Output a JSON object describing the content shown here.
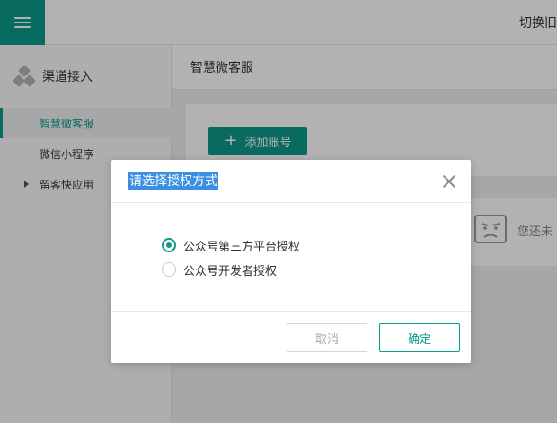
{
  "topbar": {
    "menu_icon": "hamburger-icon",
    "switch_label": "切换旧"
  },
  "sidebar": {
    "section_icon": "hexagon-cluster-icon",
    "section_title": "渠道接入",
    "items": [
      {
        "label": "智慧微客服",
        "active": true
      },
      {
        "label": "微信小程序",
        "active": false
      },
      {
        "label": "留客快应用",
        "active": false,
        "expandable": true
      }
    ]
  },
  "main": {
    "breadcrumb": "智慧微客服",
    "add_button_label": "添加账号",
    "empty_icon": "robot-face-icon",
    "empty_text": "您还未"
  },
  "dialog": {
    "title": "请选择授权方式",
    "options": [
      {
        "label": "公众号第三方平台授权",
        "checked": true
      },
      {
        "label": "公众号开发者授权",
        "checked": false
      }
    ],
    "cancel_label": "取消",
    "ok_label": "确定"
  },
  "colors": {
    "accent": "#0d9a8a",
    "title_highlight": "#3b8fe0"
  }
}
